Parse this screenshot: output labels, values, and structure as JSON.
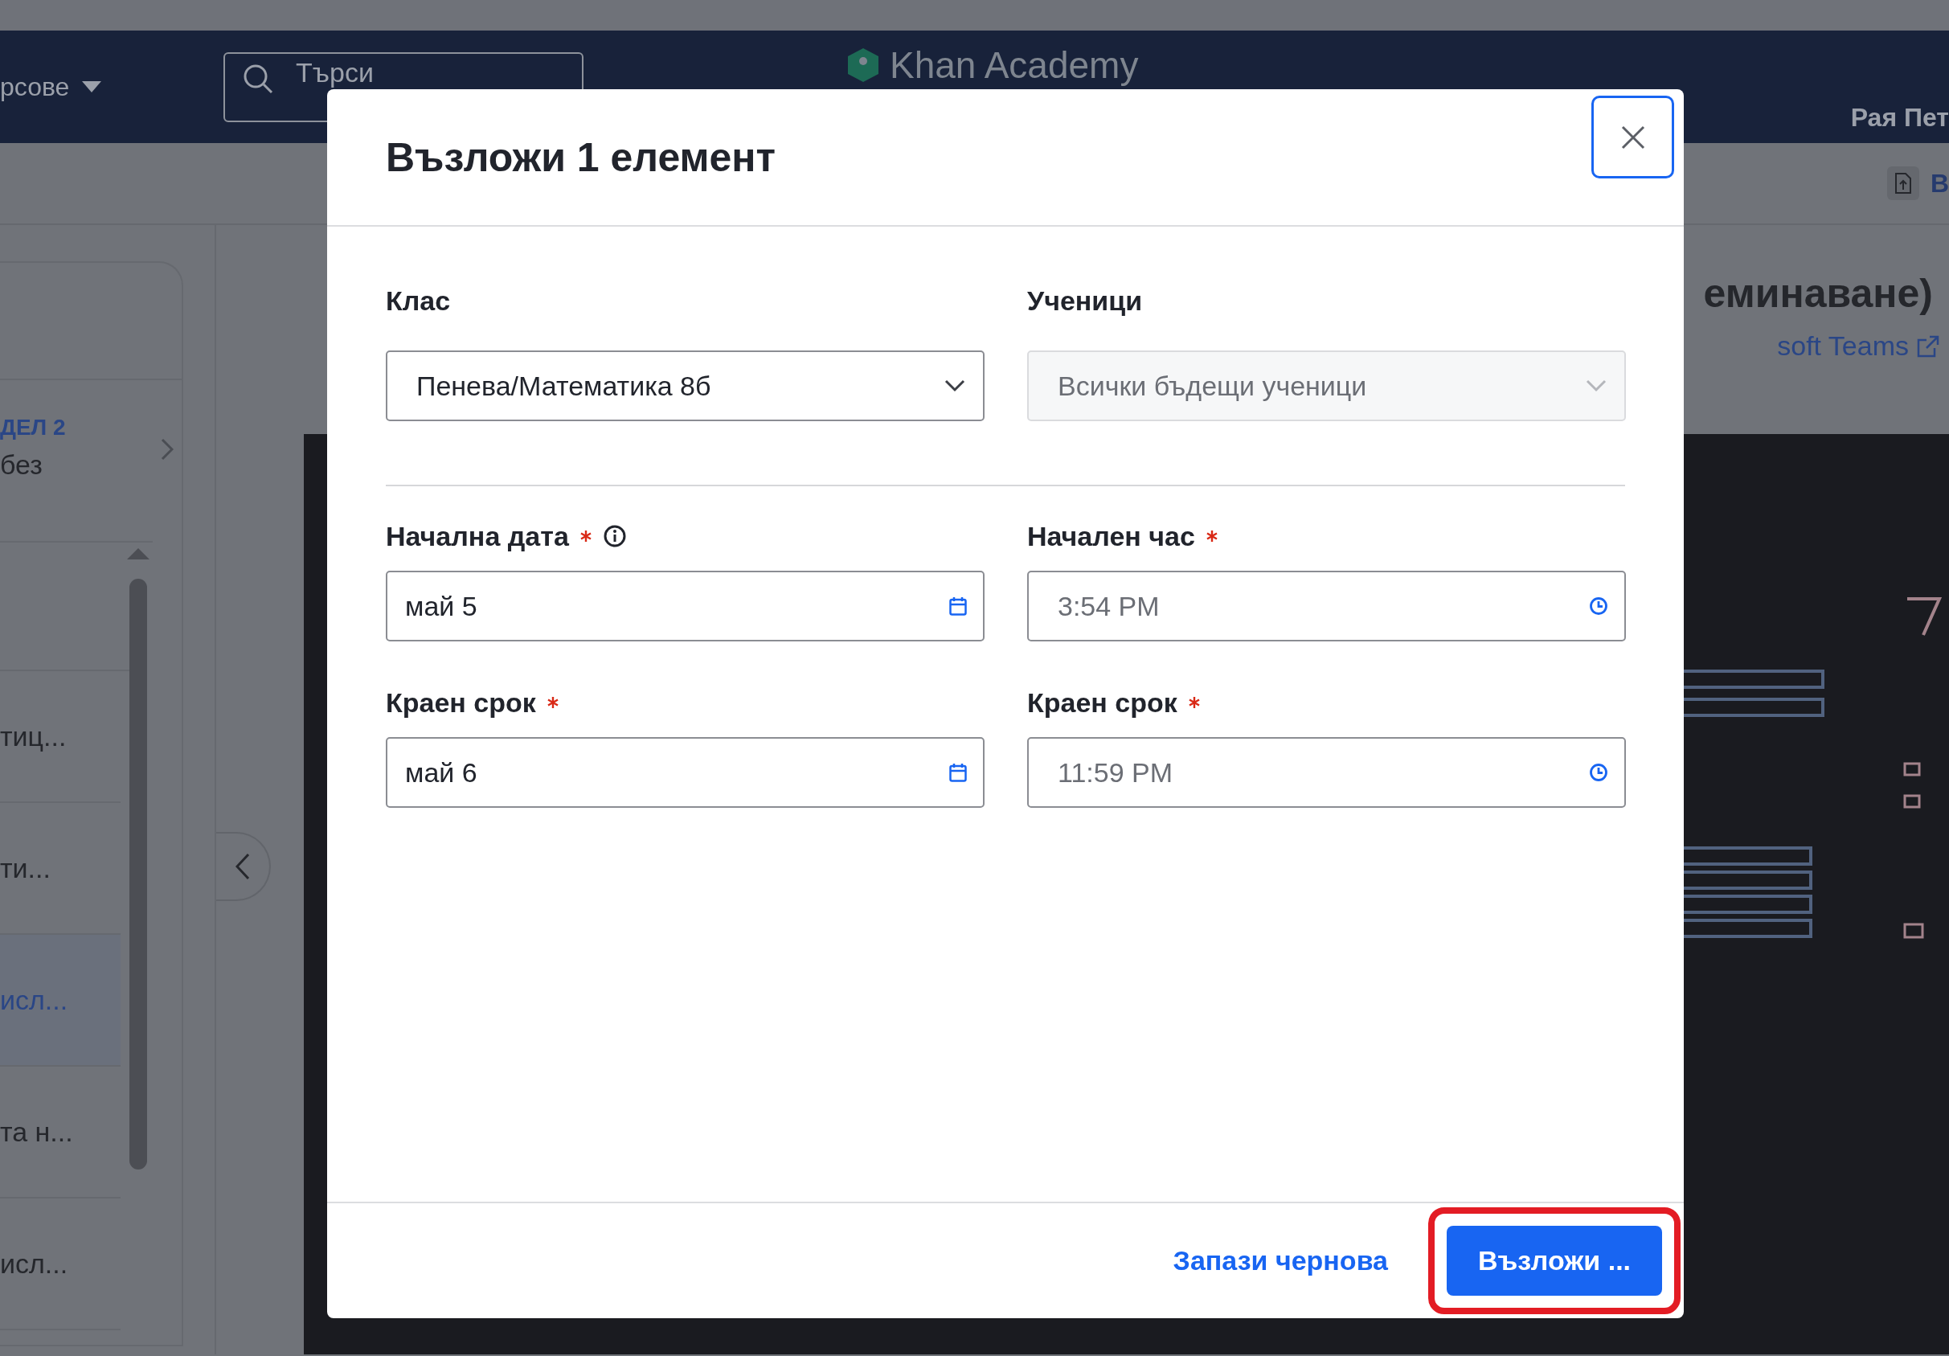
{
  "top_nav": {
    "courses_menu": "рсове",
    "search": {
      "placeholder": "Търси"
    },
    "logo": "Khan Academy",
    "user": "Рая Пет"
  },
  "subbar": {
    "button_label": "В"
  },
  "sidebar": {
    "unit_label": "ДЕЛ 2",
    "unit_title": "без",
    "items": [
      {
        "title": "тиц...",
        "selected": false
      },
      {
        "title": "ти...",
        "selected": false
      },
      {
        "title": "исл...",
        "selected": true
      },
      {
        "title": "та н...",
        "selected": false
      },
      {
        "title": "исл...",
        "selected": false
      }
    ]
  },
  "lesson": {
    "title": "еминаване)",
    "teams_link": "soft Teams"
  },
  "modal": {
    "title": "Възложи 1 елемент",
    "selects": [
      {
        "label": "Клас",
        "value": "Пенева/Математика 8б",
        "disabled": false
      },
      {
        "label": "Ученици",
        "value": "Всички бъдещи ученици",
        "disabled": true
      }
    ],
    "schedule": [
      {
        "label": "Начална дата",
        "required": true,
        "info": true,
        "kind": "date",
        "value": "май 5"
      },
      {
        "label": "Начален час",
        "required": true,
        "info": false,
        "kind": "time",
        "value": "3:54 PM"
      },
      {
        "label": "Краен срок",
        "required": true,
        "info": false,
        "kind": "date",
        "value": "май 6"
      },
      {
        "label": "Краен срок",
        "required": true,
        "info": false,
        "kind": "time",
        "value": "11:59 PM"
      }
    ],
    "draft_link": "Запази чернова",
    "assign_button": {
      "label": "Възложи ...",
      "highlighted": true
    }
  }
}
